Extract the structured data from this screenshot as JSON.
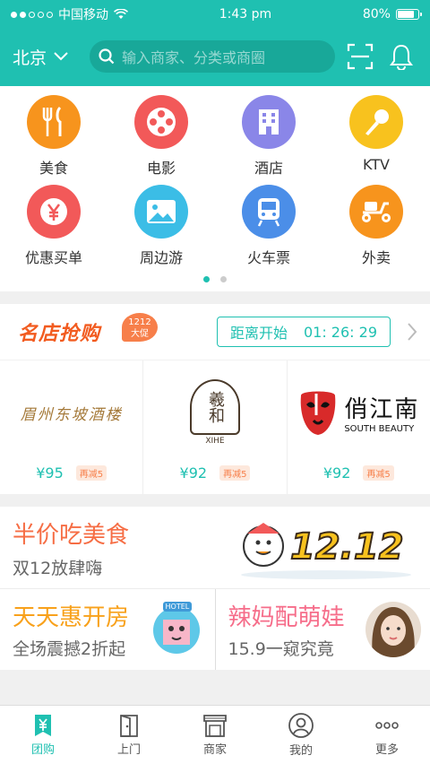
{
  "status": {
    "carrier": "中国移动",
    "time": "1:43 pm",
    "battery": "80%",
    "battery_level": 0.8
  },
  "nav": {
    "city": "北京",
    "search_placeholder": "输入商家、分类或商圈"
  },
  "categories": [
    {
      "label": "美食",
      "color": "#f7941d",
      "icon": "fork-knife-icon"
    },
    {
      "label": "电影",
      "color": "#f25959",
      "icon": "film-reel-icon"
    },
    {
      "label": "酒店",
      "color": "#8a86e8",
      "icon": "building-icon"
    },
    {
      "label": "KTV",
      "color": "#f8c21e",
      "icon": "microphone-icon"
    },
    {
      "label": "优惠买单",
      "color": "#f25959",
      "icon": "yen-icon"
    },
    {
      "label": "周边游",
      "color": "#3bbde6",
      "icon": "landscape-icon"
    },
    {
      "label": "火车票",
      "color": "#4b8ee8",
      "icon": "train-icon"
    },
    {
      "label": "外卖",
      "color": "#f7941d",
      "icon": "scooter-icon"
    }
  ],
  "flash_sale": {
    "title": "名店抢购",
    "badge_line1": "1212",
    "badge_line2": "大促",
    "countdown_label": "距离开始",
    "countdown_time": "01: 26: 29",
    "stores": [
      {
        "logo_text": "眉州东坡酒楼",
        "price": "¥95",
        "discount": "再减5"
      },
      {
        "logo_text": "羲和",
        "logo_sub": "XIHE",
        "price": "¥92",
        "discount": "再减5"
      },
      {
        "logo_text": "俏江南",
        "logo_sub": "SOUTH BEAUTY",
        "price": "¥92",
        "discount": "再减5"
      }
    ]
  },
  "banner_food": {
    "title": "半价吃美食",
    "subtitle": "双12放肆嗨",
    "art_text": "12.12"
  },
  "banner_hotel": {
    "title": "天天惠开房",
    "subtitle": "全场震撼2折起",
    "art_text": "HOTEL"
  },
  "banner_kids": {
    "title": "辣妈配萌娃",
    "subtitle": "15.9一窥究竟"
  },
  "tabs": [
    {
      "label": "团购",
      "icon": "groupon-icon",
      "active": true
    },
    {
      "label": "上门",
      "icon": "door-icon"
    },
    {
      "label": "商家",
      "icon": "shop-icon"
    },
    {
      "label": "我的",
      "icon": "user-icon"
    },
    {
      "label": "更多",
      "icon": "more-icon"
    }
  ]
}
